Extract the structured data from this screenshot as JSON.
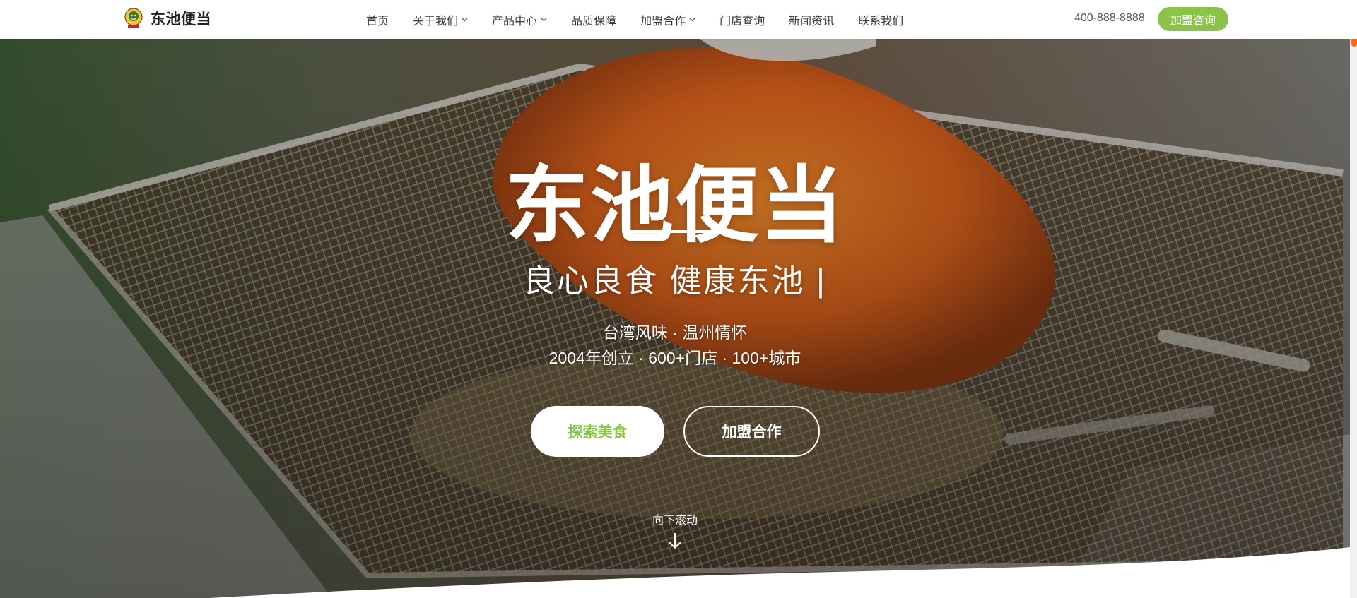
{
  "brand": {
    "name": "东池便当",
    "logo_icon": "chef-badge-icon"
  },
  "nav": {
    "items": [
      {
        "label": "首页",
        "dropdown": false
      },
      {
        "label": "关于我们",
        "dropdown": true
      },
      {
        "label": "产品中心",
        "dropdown": true
      },
      {
        "label": "品质保障",
        "dropdown": false
      },
      {
        "label": "加盟合作",
        "dropdown": true
      },
      {
        "label": "门店查询",
        "dropdown": false
      },
      {
        "label": "新闻资讯",
        "dropdown": false
      },
      {
        "label": "联系我们",
        "dropdown": false
      }
    ],
    "phone": "400-888-8888",
    "cta_label": "加盟咨询"
  },
  "hero": {
    "title": "东池便当",
    "slogan": "良心良食 健康东池 |",
    "line1": "台湾风味 · 温州情怀",
    "line2": "2004年创立 · 600+门店 · 100+城市",
    "primary_button": "探索美食",
    "secondary_button": "加盟合作",
    "scroll_hint": "向下滚动"
  },
  "colors": {
    "accent": "#8bc34a",
    "scroll_thumb": "#ff6a13",
    "nav_text": "#3a3a3a"
  }
}
